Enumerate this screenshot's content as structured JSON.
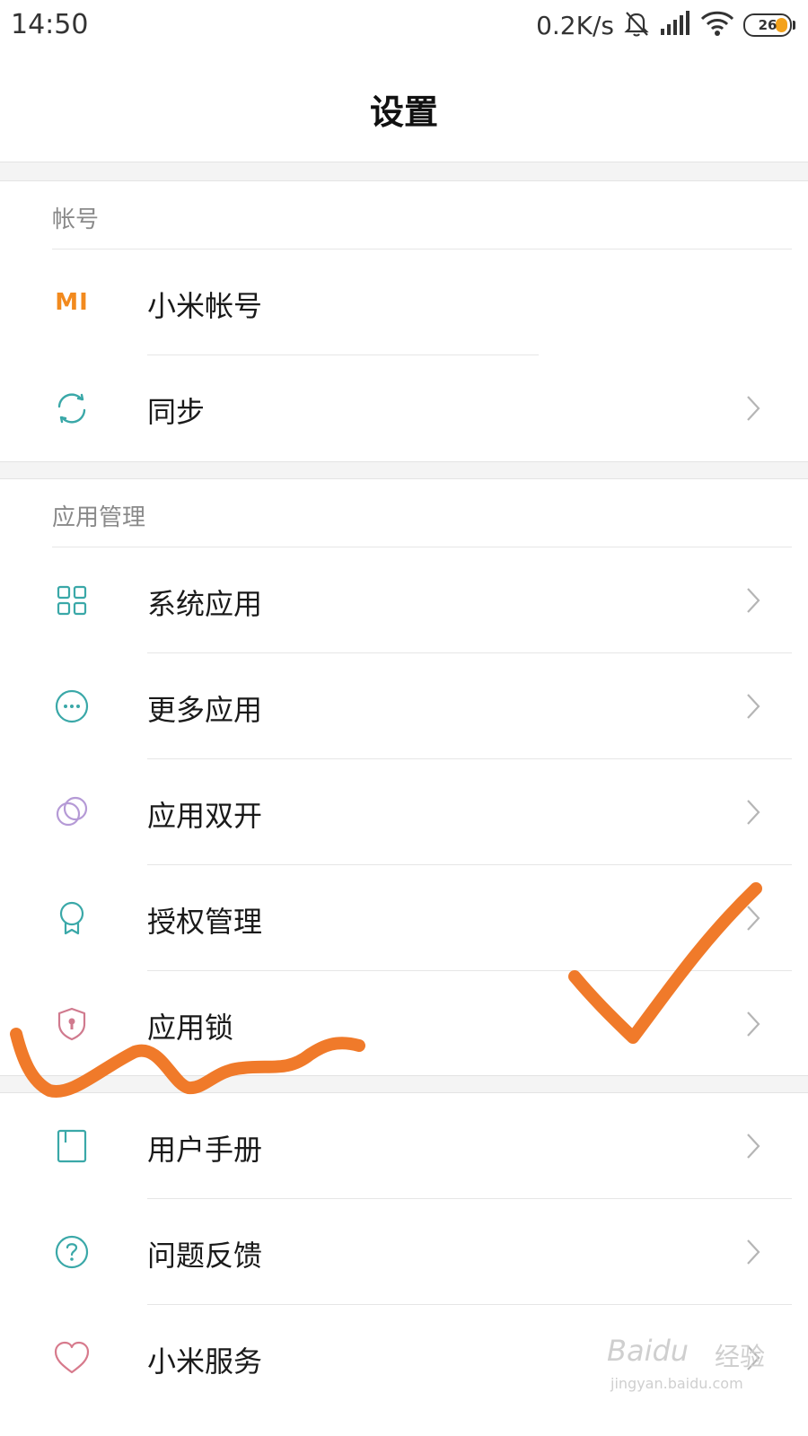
{
  "status_bar": {
    "time": "14:50",
    "net_speed": "0.2K/s",
    "battery_level": "26",
    "icons": [
      "bell-off-icon",
      "signal-icon",
      "wifi-icon",
      "battery-icon"
    ]
  },
  "header": {
    "title": "设置"
  },
  "sections": {
    "account": {
      "title": "帐号",
      "items": [
        {
          "label": "小米帐号",
          "icon": "mi-logo-icon"
        },
        {
          "label": "同步",
          "icon": "sync-icon"
        }
      ]
    },
    "apps": {
      "title": "应用管理",
      "items": [
        {
          "label": "系统应用",
          "icon": "grid-icon"
        },
        {
          "label": "更多应用",
          "icon": "more-icon"
        },
        {
          "label": "应用双开",
          "icon": "dual-app-icon"
        },
        {
          "label": "授权管理",
          "icon": "badge-icon"
        },
        {
          "label": "应用锁",
          "icon": "shield-lock-icon"
        }
      ]
    },
    "help": {
      "items": [
        {
          "label": "用户手册",
          "icon": "book-icon"
        },
        {
          "label": "问题反馈",
          "icon": "help-icon"
        },
        {
          "label": "小米服务",
          "icon": "heart-icon"
        }
      ]
    }
  },
  "mi_logo_text": "MI",
  "watermark": {
    "brand": "Baidu",
    "cn": "经验",
    "url": "jingyan.baidu.com"
  },
  "colors": {
    "accent_teal": "#3aa8a8",
    "mi_orange": "#f28a1e",
    "annotation_orange": "#f07a2a"
  }
}
